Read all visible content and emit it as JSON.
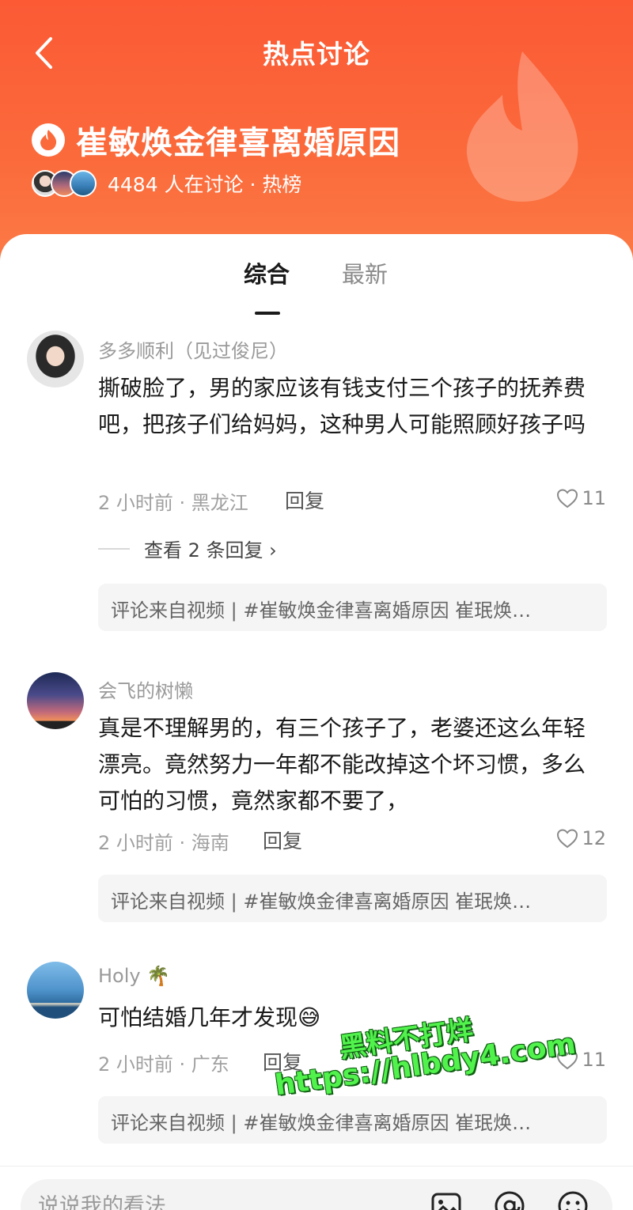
{
  "colors": {
    "header": "#fb5a35",
    "watermark": "#52f24d"
  },
  "nav": {
    "title": "热点讨论"
  },
  "topic": {
    "title": "崔敏焕金律喜离婚原因",
    "meta": "4484 人在讨论 · 热榜"
  },
  "tabs": [
    {
      "label": "综合"
    },
    {
      "label": "最新"
    }
  ],
  "comments": [
    {
      "username": "多多顺利（见过俊尼）",
      "text": "撕破脸了，男的家应该有钱支付三个孩子的抚养费吧，把孩子们给妈妈，这种男人可能照顾好孩子吗",
      "time_location": "2 小时前 · 黑龙江",
      "reply_label": "回复",
      "likes": "11",
      "view_replies": "查看 2 条回复 ›",
      "source": "评论来自视频 | #崔敏焕金律喜离婚原因 崔珉焕…"
    },
    {
      "username": "会飞的树懒",
      "text": "真是不理解男的，有三个孩子了，老婆还这么年轻漂亮。竟然努力一年都不能改掉这个坏习惯，多么可怕的习惯，竟然家都不要了，",
      "time_location": "2 小时前 · 海南",
      "reply_label": "回复",
      "likes": "12",
      "source": "评论来自视频 | #崔敏焕金律喜离婚原因 崔珉焕…"
    },
    {
      "username": "Holy 🌴",
      "text": "可怕结婚几年才发现😅",
      "time_location": "2 小时前 · 广东",
      "reply_label": "回复",
      "likes": "11",
      "source": "评论来自视频 | #崔敏焕金律喜离婚原因 崔珉焕…"
    }
  ],
  "watermark": {
    "line1": "黑料不打烊",
    "line2": "https://hlbdy4.com"
  },
  "composer": {
    "placeholder": "说说我的看法"
  }
}
